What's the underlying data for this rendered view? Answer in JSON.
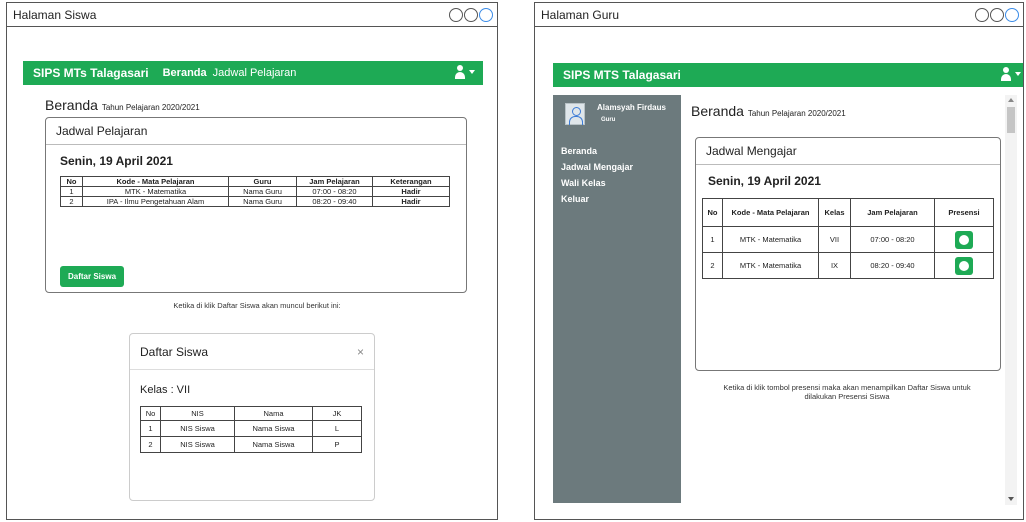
{
  "siswa": {
    "window_title": "Halaman Siswa",
    "brand": "SIPS MTs Talagasari",
    "nav": [
      "Beranda",
      "Jadwal Pelajaran"
    ],
    "heading": "Beranda",
    "heading_sub": "Tahun Pelajaran 2020/2021",
    "card_title": "Jadwal Pelajaran",
    "date": "Senin, 19 April 2021",
    "table": {
      "headers": [
        "No",
        "Kode - Mata Pelajaran",
        "Guru",
        "Jam Pelajaran",
        "Keterangan"
      ],
      "rows": [
        [
          "1",
          "MTK - Matematika",
          "Nama Guru",
          "07:00 - 08:20",
          "Hadir"
        ],
        [
          "2",
          "IPA - Ilmu Pengetahuan Alam",
          "Nama Guru",
          "08:20 - 09:40",
          "Hadir"
        ]
      ]
    },
    "button": "Daftar Siswa",
    "note": "Ketika di klik Daftar Siswa akan muncul berikut ini:",
    "modal": {
      "title": "Daftar Siswa",
      "close": "×",
      "kelas": "Kelas : VII",
      "table": {
        "headers": [
          "No",
          "NIS",
          "Nama",
          "JK"
        ],
        "rows": [
          [
            "1",
            "NIS Siswa",
            "Nama Siswa",
            "L"
          ],
          [
            "2",
            "NIS Siswa",
            "Nama Siswa",
            "P"
          ]
        ]
      }
    }
  },
  "guru": {
    "window_title": "Halaman Guru",
    "brand": "SIPS MTS Talagasari",
    "user_name": "Alamsyah Firdaus",
    "user_role": "Guru",
    "menu": [
      "Beranda",
      "Jadwal Mengajar",
      "Wali Kelas",
      "Keluar"
    ],
    "heading": "Beranda",
    "heading_sub": "Tahun Pelajaran 2020/2021",
    "card_title": "Jadwal Mengajar",
    "date": "Senin, 19 April 2021",
    "table": {
      "headers": [
        "No",
        "Kode - Mata Pelajaran",
        "Kelas",
        "Jam Pelajaran",
        "Presensi"
      ],
      "rows": [
        [
          "1",
          "MTK - Matematika",
          "VII",
          "07:00 - 08:20"
        ],
        [
          "2",
          "MTK - Matematika",
          "IX",
          "08:20 - 09:40"
        ]
      ]
    },
    "note": "Ketika di klik tombol presensi maka akan menampilkan Daftar Siswa untuk dilakukan Presensi Siswa"
  },
  "icons": {
    "user": "user-icon",
    "presensi": "circle-button-icon",
    "close": "close-icon"
  },
  "colors": {
    "primary_green": "#1eaa55",
    "sidebar_gray": "#6c7a7d"
  }
}
